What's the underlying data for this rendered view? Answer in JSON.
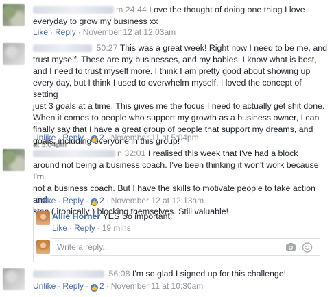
{
  "comments": [
    {
      "time": "24:44",
      "text_lines": [
        "Love the thought of doing one thing I love",
        "everyday to grow my business xx"
      ],
      "like": "Like",
      "reply": "Reply",
      "date": "November 12 at 12:03am"
    },
    {
      "time": "50:27",
      "text_lines": [
        "This was a great week! Right now I need to be me, and",
        "trust myself. These are my businesses, and my babies. I know what is best,",
        "and I need to trust myself more. I think I am pretty good about showing up",
        "every day, but I think I used to overwhelm myself. I loved the concept of setting",
        "just 3 goals at a time. This gives me the focus I need to actually get shit done.",
        "When it comes to people who support my growth as a business owner, I can",
        "finally say that I have a great group of people that support my dreams, and",
        "goals, including everyone in this group!"
      ],
      "unlike": "Unlike",
      "reply": "Reply",
      "likes": "2",
      "date": "November 11 at 5:04pm",
      "overlay": "at 5:04pm"
    },
    {
      "name_suffix": "n",
      "time": "32:01",
      "text_lines": [
        "I realised this week that I've had a block",
        "around not being a business coach. I've been thinking it won't work because I'm",
        "not a business coach. But I have the skills to motivate people to take action and",
        "stop ( ironically ) blocking themselves. Still valuable!"
      ],
      "unlike": "Unlike",
      "reply": "Reply",
      "likes": "2",
      "date": "November 12 at 12:13am"
    },
    {
      "time": "56:08",
      "text_lines": [
        "I'm so glad I signed up for this challenge!"
      ],
      "unlike": "Unlike",
      "reply": "Reply",
      "likes": "2",
      "date": "November 11 at 10:30am"
    }
  ],
  "nested_reply": {
    "author": "Allie Horner",
    "text": "YES So important!",
    "like": "Like",
    "reply": "Reply",
    "time_ago": "19 mins"
  },
  "reply_box": {
    "placeholder": "Write a reply..."
  },
  "icons": {
    "camera": "camera-icon",
    "emoji": "smiley-icon",
    "like_badge": "thumbs-up-icon"
  },
  "colors": {
    "link": "#4267b2",
    "meta": "#90949c",
    "text": "#1d2129",
    "like_badge": "#4a7bd8"
  }
}
